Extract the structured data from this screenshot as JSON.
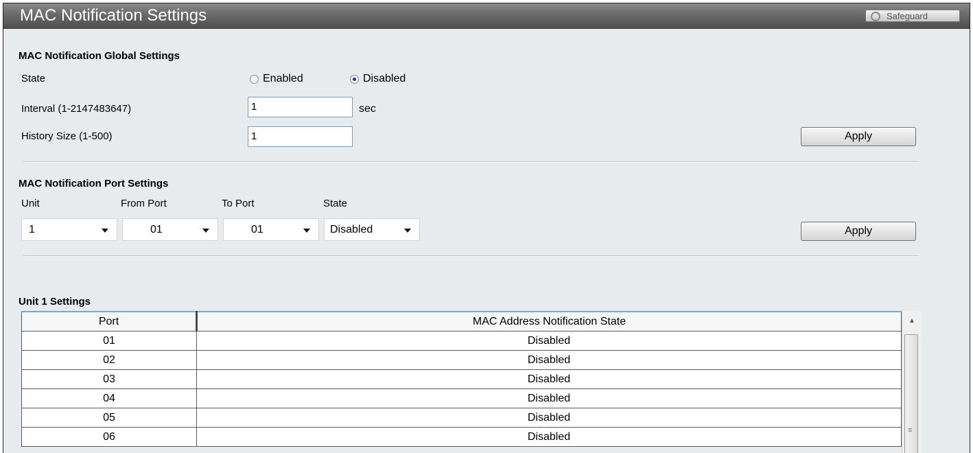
{
  "header": {
    "title": "MAC Notification Settings",
    "safeguard_label": "Safeguard"
  },
  "global": {
    "section_title": "MAC Notification Global Settings",
    "state_label": "State",
    "state_options": [
      "Enabled",
      "Disabled"
    ],
    "state_selected": "Disabled",
    "interval_label": "Interval (1-2147483647)",
    "interval_value": "1",
    "interval_unit": "sec",
    "history_label": "History Size (1-500)",
    "history_value": "1",
    "apply_label": "Apply"
  },
  "port": {
    "section_title": "MAC Notification Port Settings",
    "columns": [
      "Unit",
      "From Port",
      "To Port",
      "State"
    ],
    "unit_value": "1",
    "from_port_value": "01",
    "to_port_value": "01",
    "state_value": "Disabled",
    "apply_label": "Apply"
  },
  "unit_table": {
    "title": "Unit 1 Settings",
    "headers": [
      "Port",
      "MAC Address Notification State"
    ],
    "rows": [
      [
        "01",
        "Disabled"
      ],
      [
        "02",
        "Disabled"
      ],
      [
        "03",
        "Disabled"
      ],
      [
        "04",
        "Disabled"
      ],
      [
        "05",
        "Disabled"
      ],
      [
        "06",
        "Disabled"
      ]
    ]
  },
  "colors": {
    "title_bar": "#6a6a6a",
    "panel_bg": "#e8ebee",
    "header_accent": "#7ea7cc"
  }
}
